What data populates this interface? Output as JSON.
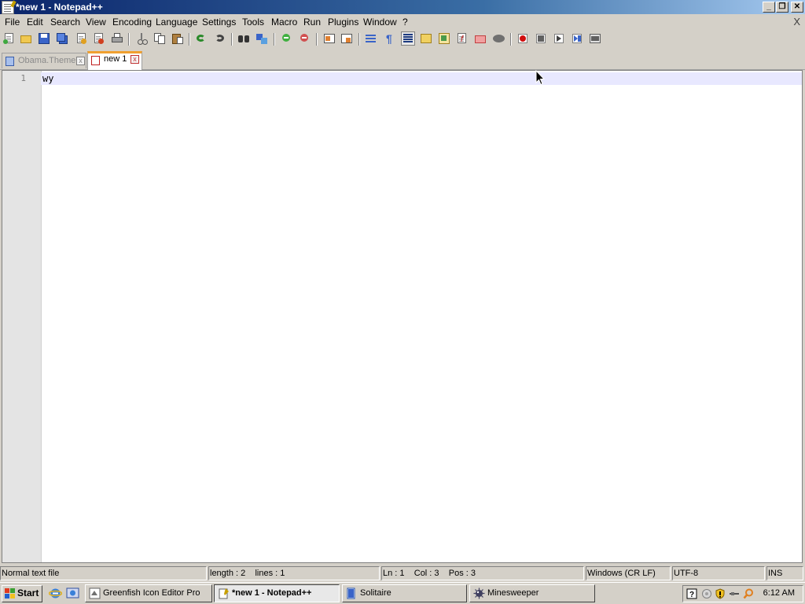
{
  "window": {
    "title": "*new 1 - Notepad++",
    "minimize_label": "_",
    "restore_label": "❐",
    "close_label": "✕"
  },
  "menu": {
    "items": [
      "File",
      "Edit",
      "Search",
      "View",
      "Encoding",
      "Language",
      "Settings",
      "Tools",
      "Macro",
      "Run",
      "Plugins",
      "Window",
      "?"
    ],
    "close_doc_label": "X"
  },
  "toolbar": {
    "buttons": [
      "new",
      "open",
      "save",
      "save-all",
      "close",
      "close-all",
      "print",
      "cut",
      "copy",
      "paste",
      "undo",
      "redo",
      "find",
      "replace",
      "zoom-in",
      "zoom-out",
      "sync-vertical",
      "sync-horizontal",
      "word-wrap",
      "show-all-chars",
      "indent-guide",
      "user-defined-language",
      "doc-map",
      "function-list",
      "folder-as-workspace",
      "monitoring",
      "record-macro",
      "stop-recording",
      "playback-macro",
      "run-macro-multiple",
      "save-macro"
    ]
  },
  "tabs": [
    {
      "label": "Obama.Theme",
      "active": false,
      "close_label": "x"
    },
    {
      "label": "new 1",
      "active": true,
      "close_label": "x"
    }
  ],
  "editor": {
    "line_number": "1",
    "content": "wy"
  },
  "statusbar": {
    "file_type": "Normal text file",
    "length": "length : 2    lines : 1",
    "position": "Ln : 1    Col : 3    Pos : 3",
    "eol": "Windows (CR LF)",
    "encoding": "UTF-8",
    "mode": "INS"
  },
  "taskbar": {
    "start_label": "Start",
    "tasks": [
      {
        "label": "Greenfish Icon Editor Pro",
        "active": false
      },
      {
        "label": "*new 1 - Notepad++",
        "active": true
      },
      {
        "label": "Solitaire",
        "active": false
      },
      {
        "label": "Minesweeper",
        "active": false
      }
    ],
    "clock": "6:12 AM"
  }
}
